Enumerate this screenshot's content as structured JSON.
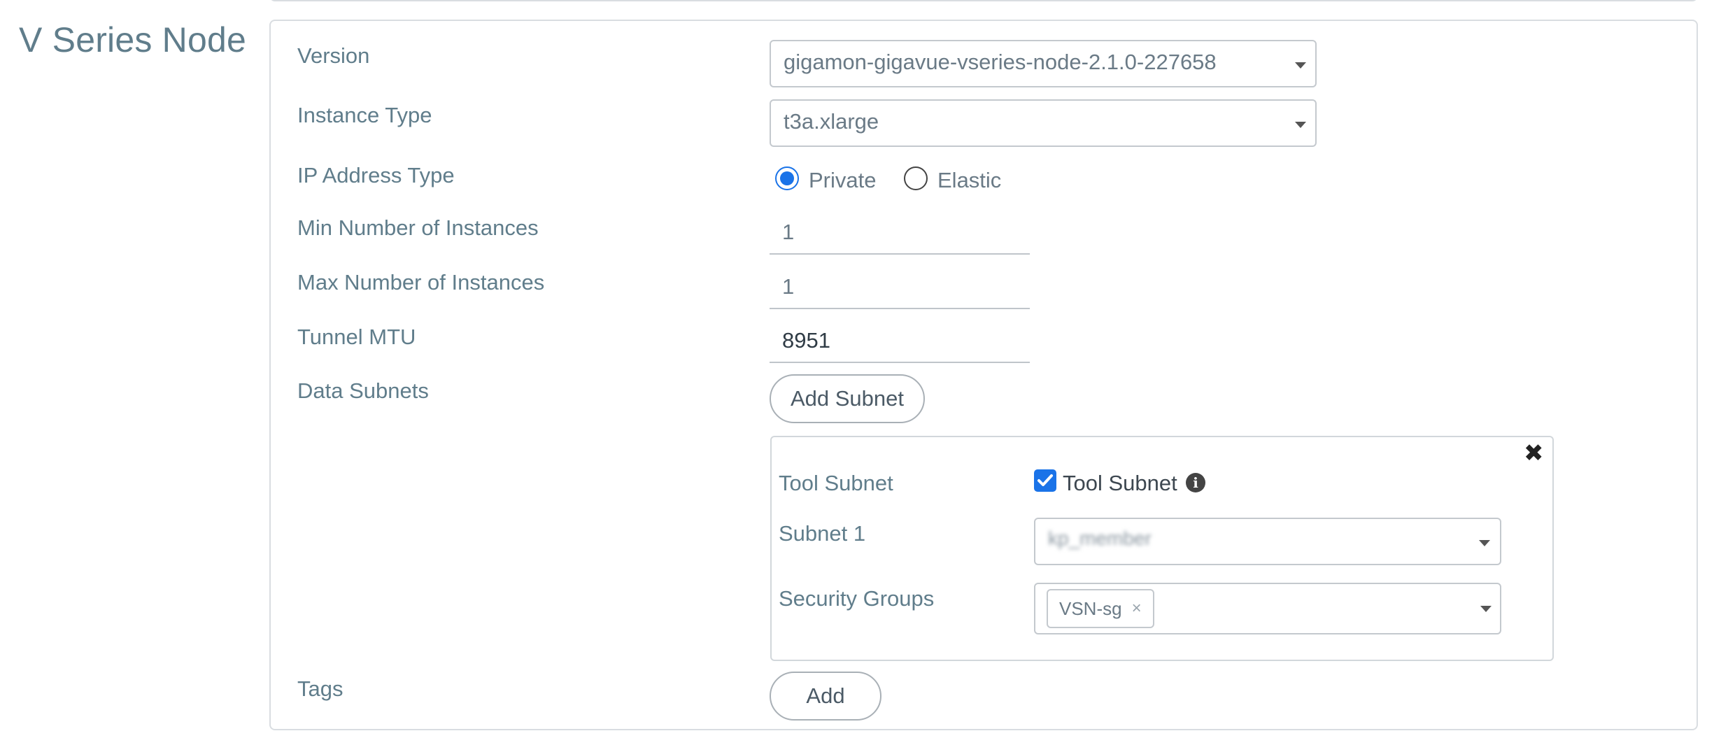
{
  "section_title": "V Series Node",
  "fields": {
    "version": {
      "label": "Version",
      "value": "gigamon-gigavue-vseries-node-2.1.0-227658"
    },
    "instance_type": {
      "label": "Instance Type",
      "value": "t3a.xlarge"
    },
    "ip_address_type": {
      "label": "IP Address Type",
      "options": [
        {
          "label": "Private",
          "selected": true
        },
        {
          "label": "Elastic",
          "selected": false
        }
      ]
    },
    "min_instances": {
      "label": "Min Number of Instances",
      "value": "1"
    },
    "max_instances": {
      "label": "Max Number of Instances",
      "value": "1"
    },
    "tunnel_mtu": {
      "label": "Tunnel MTU",
      "value": "8951"
    },
    "data_subnets": {
      "label": "Data Subnets",
      "button_label": "Add Subnet"
    },
    "tags": {
      "label": "Tags",
      "button_label": "Add"
    }
  },
  "subnet_entry": {
    "close_glyph": "✖",
    "tool_subnet": {
      "label": "Tool Subnet",
      "checkbox_label": "Tool Subnet",
      "checked": true
    },
    "subnet_1": {
      "label": "Subnet 1",
      "value": "kp_member"
    },
    "security_groups": {
      "label": "Security Groups",
      "chips": [
        "VSN-sg"
      ],
      "chip_remove_glyph": "×"
    }
  },
  "colors": {
    "accent": "#1a73e8",
    "label": "#607d8b",
    "border": "#d9dde1"
  }
}
